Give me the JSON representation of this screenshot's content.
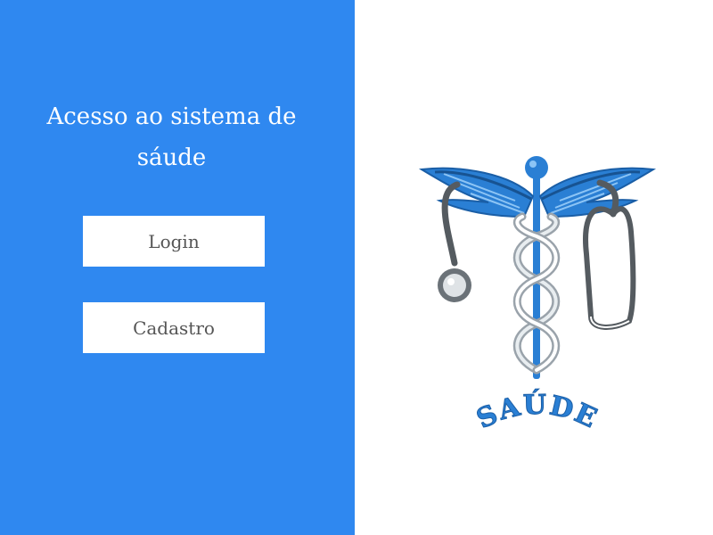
{
  "login_screen": {
    "title": "Acesso ao sistema de sáude",
    "login_label": "Login",
    "register_label": "Cadastro"
  },
  "logo": {
    "text": "SAÚDE",
    "icon": "caduceus-stethoscope-icon"
  },
  "colors": {
    "panel": "#2f88f0",
    "logo_blue": "#2a7fd4",
    "button_text": "#555555"
  }
}
